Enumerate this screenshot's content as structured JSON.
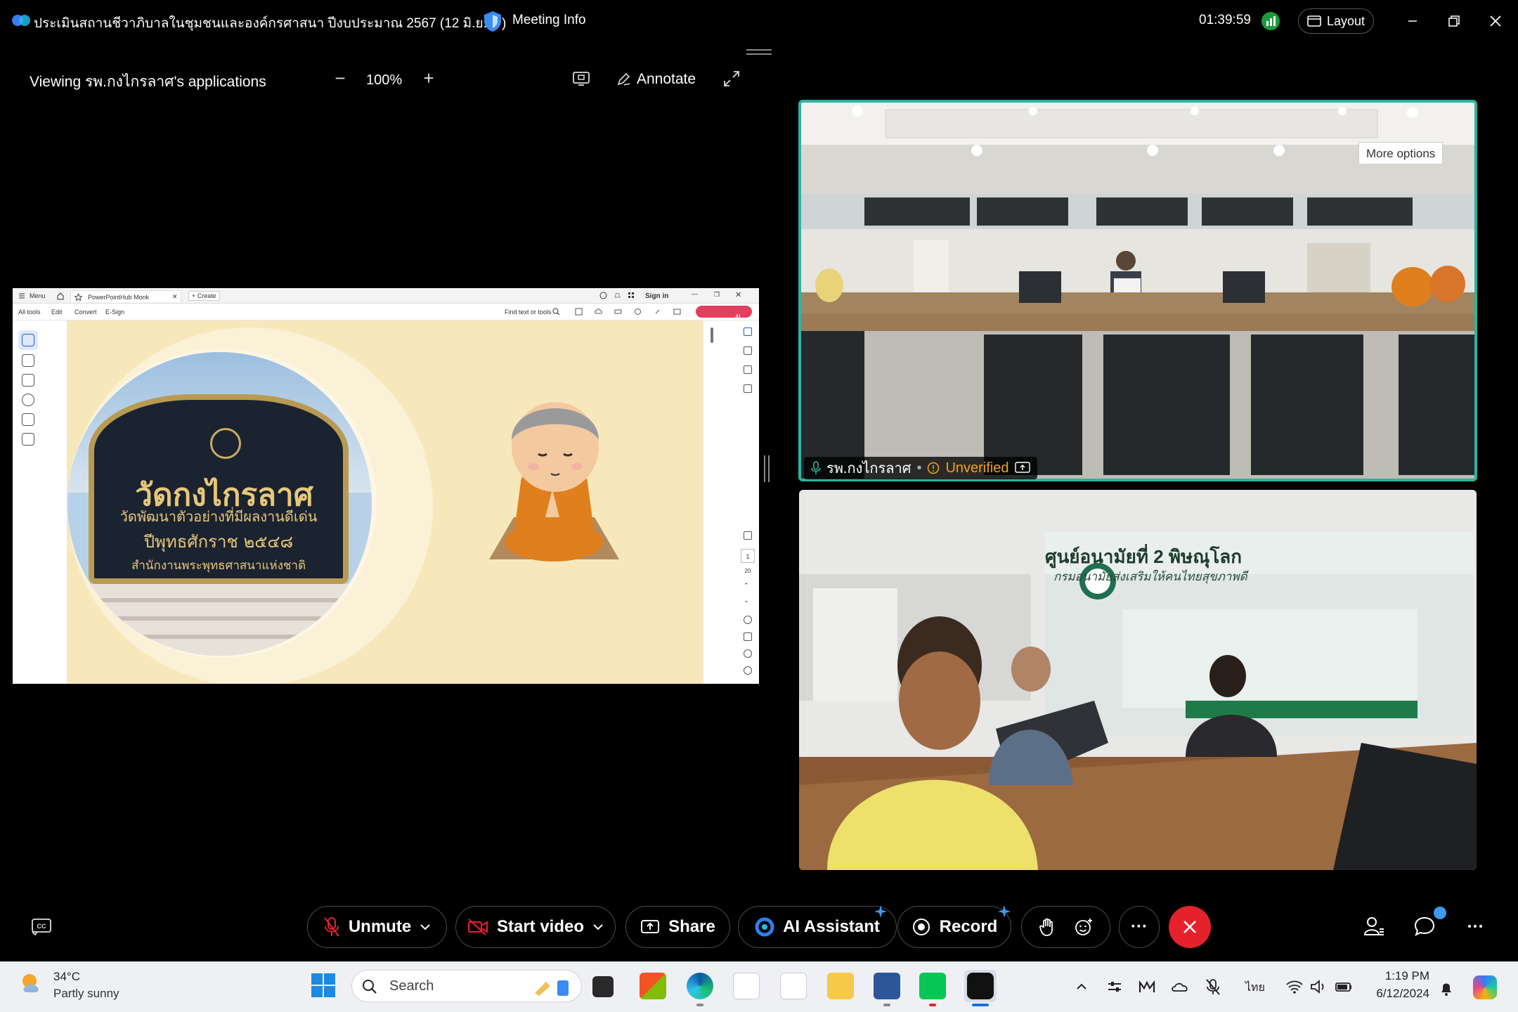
{
  "window": {
    "meeting_title": "ประเมินสถานชีวาภิบาลในชุมชนและองค์กรศาสนา ปีงบประมาณ 2567 (12 มิ.ย.67)",
    "meeting_info_label": "Meeting Info",
    "timer": "01:39:59",
    "layout_label": "Layout"
  },
  "share_toolbar": {
    "viewing_label": "Viewing รพ.กงไกรลาศ's applications",
    "zoom_minus": "−",
    "zoom_value": "100%",
    "zoom_plus": "+",
    "annotate_label": "Annotate"
  },
  "pdf_viewer": {
    "menu_label": "Menu",
    "tab_title": "PowerPointHub Monk",
    "new_tab_label": "+ Create",
    "sign_in": "Sign in",
    "menus": [
      "All tools",
      "Edit",
      "Convert",
      "E-Sign"
    ],
    "find_label": "Find text or tools",
    "ai_assistant_label": "AI Assistant",
    "page_current": "1",
    "page_total": "20"
  },
  "slide": {
    "sign_main": "วัดกงไกรลาศ",
    "sign_line1": "วัดพัฒนาตัวอย่างที่มีผลงานดีเด่น",
    "sign_line2": "ปีพุทธศักราช ๒๕๔๘",
    "sign_line3": "สำนักงานพระพุทธศาสนาแห่งชาติ"
  },
  "video": {
    "tile1_name": "รพ.กงไกรลาศ",
    "tile1_status": "Unverified",
    "more_options_label": "More options",
    "tile2_banner_title": "ศูนย์อนามัยที่ 2 พิษณุโลก",
    "tile2_banner_sub": "กรมอนามัยส่งเสริมให้คนไทยสุขภาพดี"
  },
  "controls": {
    "unmute_label": "Unmute",
    "start_video_label": "Start video",
    "share_label": "Share",
    "ai_assistant_label": "AI Assistant",
    "record_label": "Record",
    "more_label": "···"
  },
  "taskbar": {
    "weather_temp": "34°C",
    "weather_desc": "Partly sunny",
    "search_label": "Search",
    "language": "ไทย",
    "time": "1:19 PM",
    "date": "6/12/2024"
  },
  "colors": {
    "active_speaker_border": "#2ab59f",
    "leave_button": "#e5222c",
    "unverified": "#f2a31a",
    "slide_background": "#f7e8bc",
    "robe": "#e07f1e"
  }
}
